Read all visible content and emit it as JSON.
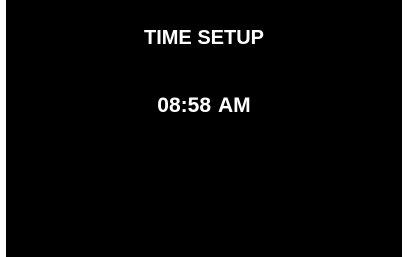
{
  "screen": {
    "title": "TIME SETUP",
    "time": "08:58",
    "period": "AM",
    "background_color": "#000000",
    "text_color": "#ffffff"
  }
}
